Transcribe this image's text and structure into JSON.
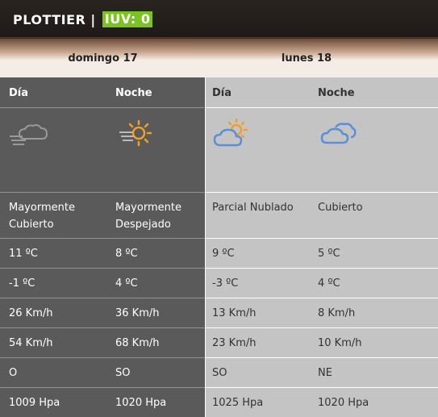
{
  "header": {
    "location": "PLOTTIER |",
    "iuv": "IUV: 0"
  },
  "days": [
    {
      "name": "domingo 17"
    },
    {
      "name": "lunes 18"
    }
  ],
  "columns": [
    {
      "period": "Día",
      "icon": "cloud-wind-icon",
      "description": "Mayormente Cubierto",
      "temp_max": "11 ºC",
      "temp_min": "-1 ºC",
      "wind": "26 Km/h",
      "gust": "54 Km/h",
      "direction": "O",
      "pressure": "1009 Hpa"
    },
    {
      "period": "Noche",
      "icon": "sun-wind-icon",
      "description": "Mayormente Despejado",
      "temp_max": "8 ºC",
      "temp_min": "4 ºC",
      "wind": "36 Km/h",
      "gust": "68 Km/h",
      "direction": "SO",
      "pressure": "1020 Hpa"
    },
    {
      "period": "Día",
      "icon": "partly-cloudy-icon",
      "description": "Parcial Nublado",
      "temp_max": "9 ºC",
      "temp_min": "-3 ºC",
      "wind": "13 Km/h",
      "gust": "23 Km/h",
      "direction": "SO",
      "pressure": "1025 Hpa"
    },
    {
      "period": "Noche",
      "icon": "cloudy-icon",
      "description": "Cubierto",
      "temp_max": "5 ºC",
      "temp_min": "4 ºC",
      "wind": "8 Km/h",
      "gust": "10 Km/h",
      "direction": "NE",
      "pressure": "1020 Hpa"
    }
  ],
  "colors": {
    "dark_column": "#5a5a5a",
    "light_column": "#c4c4c4",
    "iuv_badge": "#7bc41f",
    "sun_orange": "#f0a028",
    "cloud_blue": "#5b8fd6",
    "cloud_grey": "#9a9a9a"
  }
}
